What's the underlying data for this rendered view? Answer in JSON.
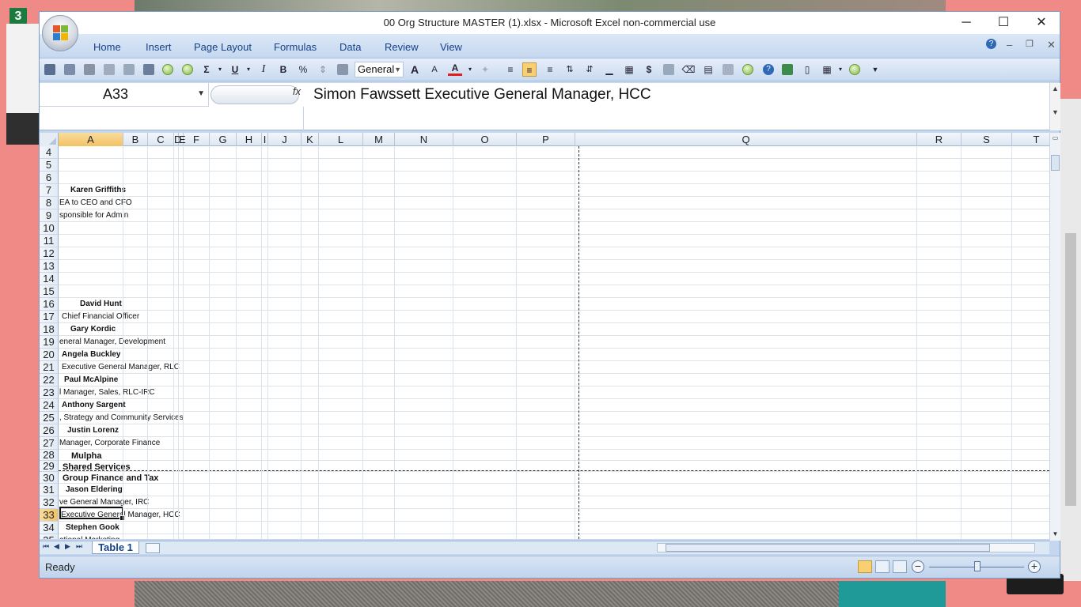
{
  "window": {
    "title": "00 Org Structure MASTER (1).xlsx - Microsoft Excel non-commercial use",
    "minimize": "─",
    "maximize": "☐",
    "close": "✕"
  },
  "menu": {
    "items": [
      "Home",
      "Insert",
      "Page Layout",
      "Formulas",
      "Data",
      "Review",
      "View"
    ],
    "help": "?",
    "doc_min": "–",
    "doc_restore": "❐",
    "doc_close": "✕"
  },
  "toolbar": {
    "number_format": "General",
    "sum": "Σ",
    "underline": "U",
    "italic": "I",
    "bold": "B",
    "percent": "%",
    "grow_font": "A",
    "shrink_font": "A",
    "font_color": "A"
  },
  "formula_bar": {
    "name_box": "A33",
    "fx": "fx",
    "content": "Simon Fawssett Executive General Manager, HCC"
  },
  "columns": [
    "A",
    "B",
    "C",
    "D",
    "E",
    "F",
    "G",
    "H",
    "I",
    "J",
    "K",
    "L",
    "M",
    "N",
    "O",
    "P",
    "Q",
    "R",
    "S",
    "T"
  ],
  "rows": [
    "4",
    "5",
    "6",
    "7",
    "8",
    "9",
    "10",
    "11",
    "12",
    "13",
    "14",
    "15",
    "16",
    "17",
    "18",
    "19",
    "20",
    "21",
    "22",
    "23",
    "24",
    "25",
    "26",
    "27",
    "28",
    "29",
    "30",
    "31",
    "32",
    "33",
    "34",
    "35"
  ],
  "cells": {
    "r7": "Karen Griffiths",
    "r8": "EA to CEO and CFO",
    "r9": "sponsible for Admin",
    "r16": "David Hunt",
    "r17": "Chief Financial Officer",
    "r18": "Gary Kordic",
    "r19": "eneral Manager, Development",
    "r20": "Angela Buckley",
    "r21": "Executive General Manager, RLC",
    "r22": "Paul McAlpine",
    "r23": "l Manager, Sales, RLC-IRC",
    "r24": "Anthony Sargent",
    "r25": ", Strategy and Community Services",
    "r26": "Justin Lorenz",
    "r27": "Manager, Corporate Finance",
    "r28": "Mulpha",
    "r29": "Shared Services",
    "r30": "Group Finance and Tax",
    "r31": "Jason Eldering",
    "r32": "ve General Manager, IRC",
    "r33": "Executive General Manager, HCC",
    "r34": "Stephen Gook",
    "r35": "ational Marketing"
  },
  "sheet_tabs": [
    "Table 1"
  ],
  "status": {
    "ready": "Ready",
    "zoom_out": "−",
    "zoom_in": "+"
  },
  "desktop": {
    "badge": "3"
  }
}
